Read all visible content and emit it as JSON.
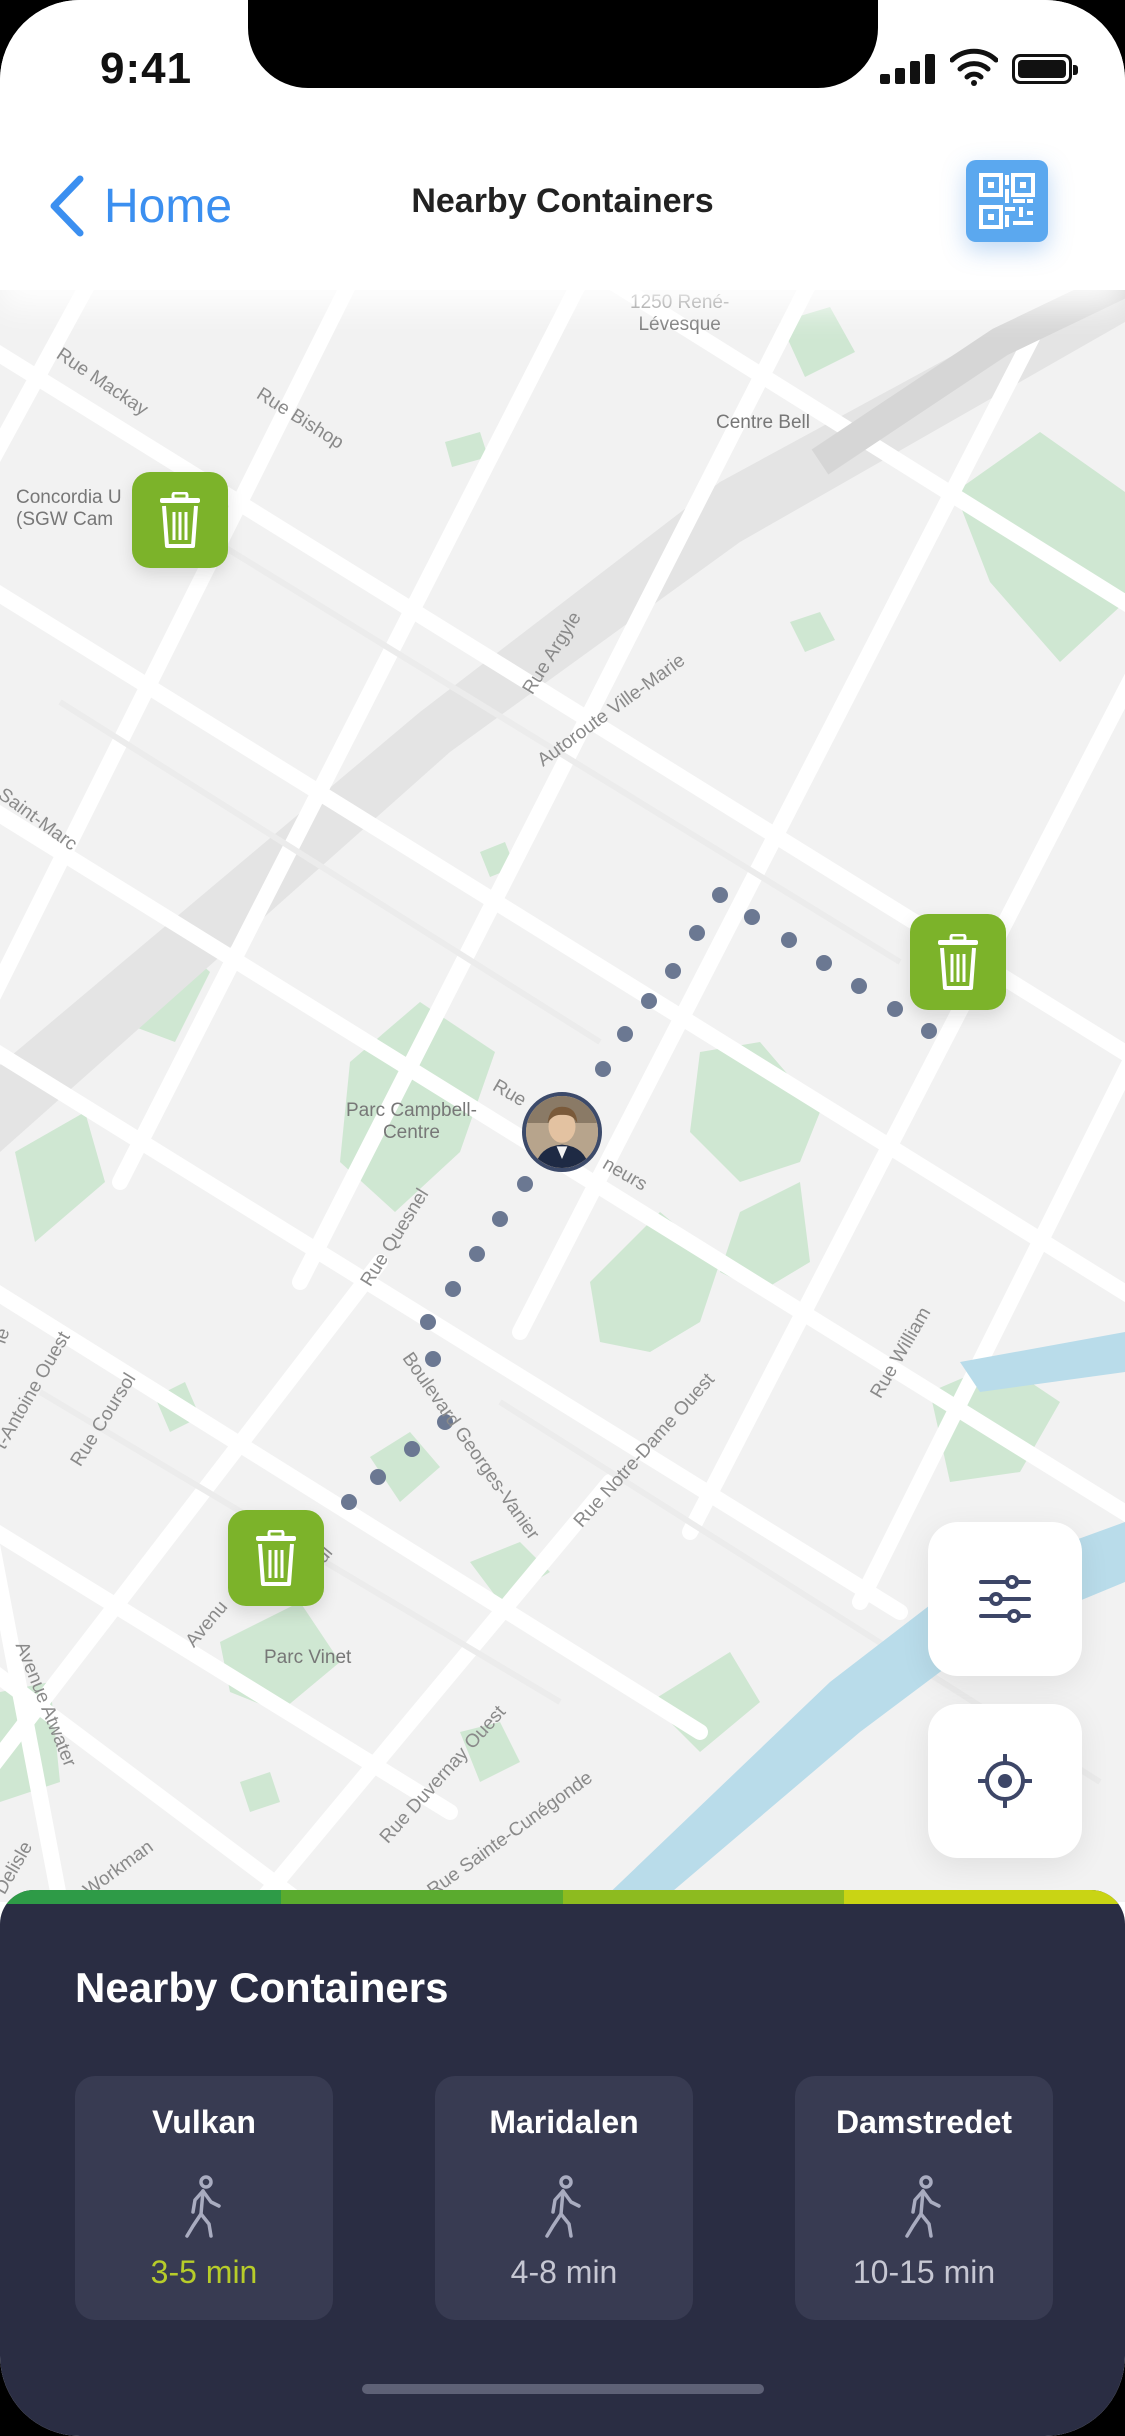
{
  "status_bar": {
    "time": "9:41"
  },
  "nav": {
    "back_label": "Home",
    "title": "Nearby Containers"
  },
  "icons": {
    "back": "chevron-left-icon",
    "qr": "qr-code-icon",
    "trash": "trash-icon",
    "filters": "sliders-icon",
    "locate": "crosshair-icon",
    "walk": "walking-person-icon"
  },
  "map": {
    "places": [
      "1250 René-\nLévesque",
      "Centre Bell",
      "Concordia U\n(SGW Cam",
      "Parc Campbell-\nCentre",
      "Parc Vinet"
    ],
    "streets": [
      "Rue Mackay",
      "Rue Bishop",
      "Rue Argyle",
      "Autoroute Ville-Marie",
      "Saint-Marc",
      "Rue",
      "neurs",
      "Rue Quesnel",
      "Boulevard Georges-Vanier",
      "Rue Notre-Dame Ouest",
      "Rue William",
      "t-Antoine Ouest",
      "Rue Coursol",
      "Avenu",
      "ul",
      "Avenue Atwater",
      "Rue Duvernay Ouest",
      "Rue Sainte-Cunégonde",
      "Delisle",
      "Workman",
      "ie"
    ]
  },
  "sheet": {
    "title": "Nearby Containers",
    "cards": [
      {
        "name": "Vulkan",
        "time": "3-5 min",
        "active": true
      },
      {
        "name": "Maridalen",
        "time": "4-8 min",
        "active": false
      },
      {
        "name": "Damstredet",
        "time": "10-15 min",
        "active": false
      }
    ]
  },
  "colors": {
    "accent_blue": "#3b8ff0",
    "pin_green": "#7cb32a",
    "sheet_bg": "#2a2d43",
    "card_bg": "#383b52",
    "active_time": "#b7cc2a",
    "route_dots": "#6b7892",
    "strip": [
      "#2e9b47",
      "#5aab2e",
      "#8dbb1f",
      "#c9d414"
    ]
  }
}
